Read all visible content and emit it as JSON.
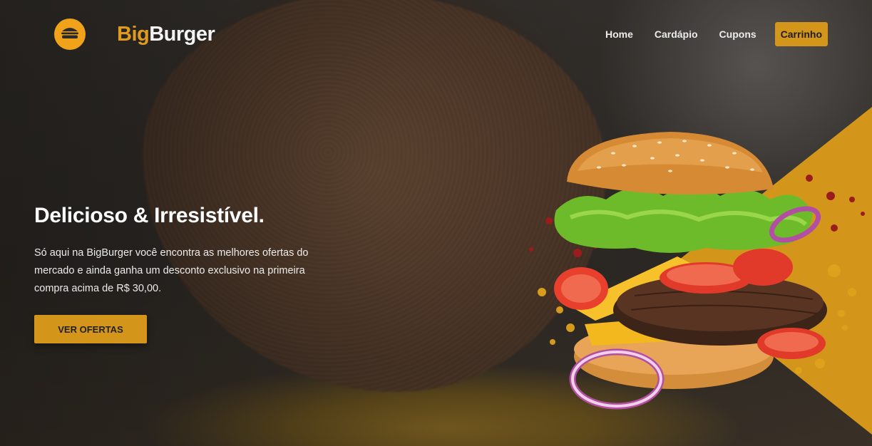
{
  "brand": {
    "name_part1": "Big",
    "name_part2": "Burger",
    "logo_icon": "burger-icon"
  },
  "nav": {
    "items": [
      {
        "label": "Home"
      },
      {
        "label": "Cardápio"
      },
      {
        "label": "Cupons"
      }
    ],
    "cart_label": "Carrinho"
  },
  "hero": {
    "title": "Delicioso & Irresistível.",
    "description": "Só aqui na BigBurger você encontra as melhores ofertas do mercado e ainda ganha um desconto exclusivo na primeira compra acima de R$ 30,00.",
    "cta_label": "VER OFERTAS"
  },
  "colors": {
    "accent": "#d3961a",
    "logo_orange": "#f0a21b",
    "text_light": "#ffffff"
  }
}
